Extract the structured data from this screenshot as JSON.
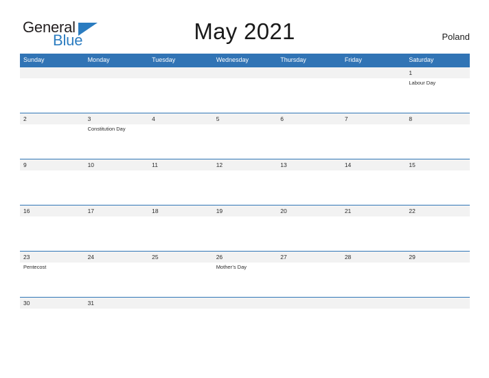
{
  "brand": {
    "word_one": "General",
    "word_two": "Blue",
    "triangle_icon": "triangle-icon",
    "accent_color": "#2b7cc0"
  },
  "header": {
    "title": "May 2021",
    "region": "Poland"
  },
  "theme": {
    "header_blue": "#3174b5",
    "row_border_blue": "#2e75b6",
    "date_band_gray": "#f2f2f2",
    "text_color": "#2b2b2b"
  },
  "calendar": {
    "month": "May",
    "year": "2021",
    "weekday_headers": [
      "Sunday",
      "Monday",
      "Tuesday",
      "Wednesday",
      "Thursday",
      "Friday",
      "Saturday"
    ],
    "weeks": [
      {
        "short": false,
        "days": [
          {
            "date": "",
            "event": ""
          },
          {
            "date": "",
            "event": ""
          },
          {
            "date": "",
            "event": ""
          },
          {
            "date": "",
            "event": ""
          },
          {
            "date": "",
            "event": ""
          },
          {
            "date": "",
            "event": ""
          },
          {
            "date": "1",
            "event": "Labour Day"
          }
        ]
      },
      {
        "short": false,
        "days": [
          {
            "date": "2",
            "event": ""
          },
          {
            "date": "3",
            "event": "Constitution Day"
          },
          {
            "date": "4",
            "event": ""
          },
          {
            "date": "5",
            "event": ""
          },
          {
            "date": "6",
            "event": ""
          },
          {
            "date": "7",
            "event": ""
          },
          {
            "date": "8",
            "event": ""
          }
        ]
      },
      {
        "short": false,
        "days": [
          {
            "date": "9",
            "event": ""
          },
          {
            "date": "10",
            "event": ""
          },
          {
            "date": "11",
            "event": ""
          },
          {
            "date": "12",
            "event": ""
          },
          {
            "date": "13",
            "event": ""
          },
          {
            "date": "14",
            "event": ""
          },
          {
            "date": "15",
            "event": ""
          }
        ]
      },
      {
        "short": false,
        "days": [
          {
            "date": "16",
            "event": ""
          },
          {
            "date": "17",
            "event": ""
          },
          {
            "date": "18",
            "event": ""
          },
          {
            "date": "19",
            "event": ""
          },
          {
            "date": "20",
            "event": ""
          },
          {
            "date": "21",
            "event": ""
          },
          {
            "date": "22",
            "event": ""
          }
        ]
      },
      {
        "short": false,
        "days": [
          {
            "date": "23",
            "event": "Pentecost"
          },
          {
            "date": "24",
            "event": ""
          },
          {
            "date": "25",
            "event": ""
          },
          {
            "date": "26",
            "event": "Mother’s Day"
          },
          {
            "date": "27",
            "event": ""
          },
          {
            "date": "28",
            "event": ""
          },
          {
            "date": "29",
            "event": ""
          }
        ]
      },
      {
        "short": true,
        "days": [
          {
            "date": "30",
            "event": ""
          },
          {
            "date": "31",
            "event": ""
          },
          {
            "date": "",
            "event": ""
          },
          {
            "date": "",
            "event": ""
          },
          {
            "date": "",
            "event": ""
          },
          {
            "date": "",
            "event": ""
          },
          {
            "date": "",
            "event": ""
          }
        ]
      }
    ]
  }
}
